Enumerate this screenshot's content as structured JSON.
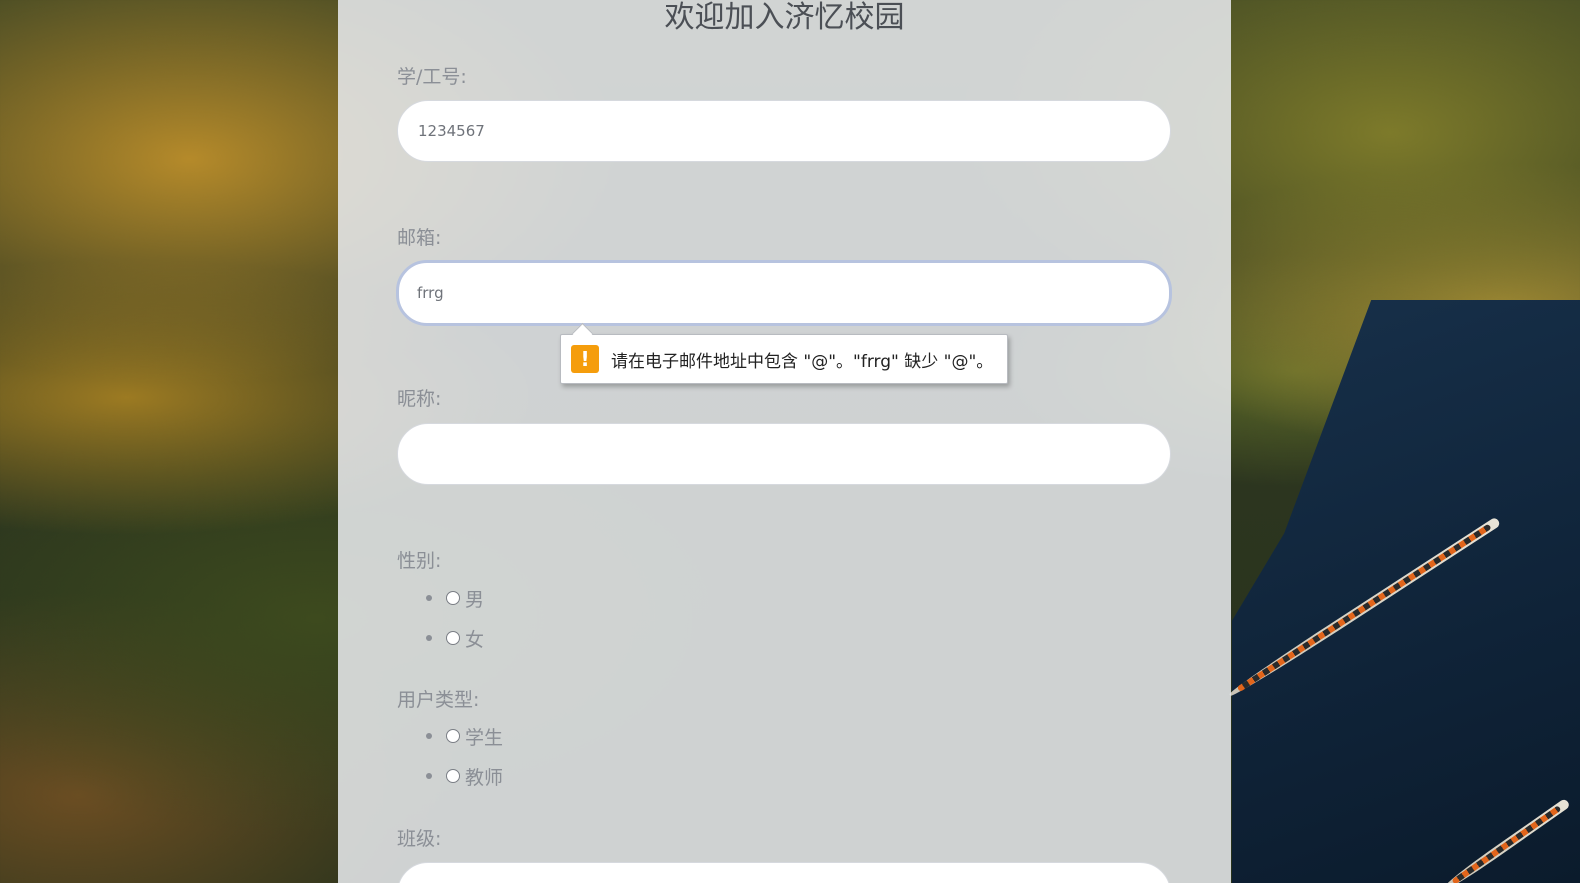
{
  "page": {
    "title": "欢迎加入济忆校园"
  },
  "form": {
    "id_label": "学/工号:",
    "id_value": "1234567",
    "email_label": "邮箱:",
    "email_value": "frrg",
    "nickname_label": "昵称:",
    "nickname_value": "",
    "gender_label": "性别:",
    "gender_options": [
      "男",
      "女"
    ],
    "user_type_label": "用户类型:",
    "user_type_options": [
      "学生",
      "教师"
    ],
    "class_label": "班级:"
  },
  "validation": {
    "icon": "warning-icon",
    "icon_glyph": "!",
    "message": "请在电子邮件地址中包含 \"@\"。\"frrg\" 缺少 \"@\"。",
    "icon_color": "#f59d0c"
  }
}
